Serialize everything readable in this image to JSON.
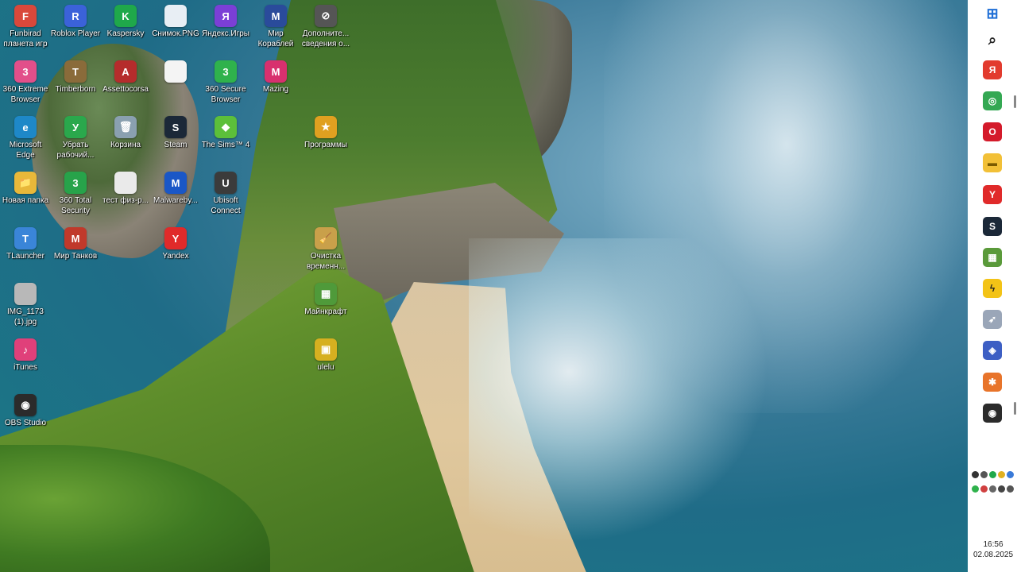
{
  "desktop_icons": [
    {
      "label": "Funbirad\nпланета игр",
      "glyph": "F",
      "color": "#d9483b",
      "col": 0,
      "row": 0
    },
    {
      "label": "Roblox Player",
      "glyph": "R",
      "color": "#3b62d9",
      "col": 1,
      "row": 0
    },
    {
      "label": "Kaspersky",
      "glyph": "K",
      "color": "#1fa84a",
      "col": 2,
      "row": 0
    },
    {
      "label": "Снимок.PNG",
      "glyph": "",
      "color": "#e8eef4",
      "col": 3,
      "row": 0
    },
    {
      "label": "Яндекс.Игры",
      "glyph": "Я",
      "color": "#7b3fd6",
      "col": 4,
      "row": 0
    },
    {
      "label": "Мир\nКораблей",
      "glyph": "M",
      "color": "#2a4b9b",
      "col": 5,
      "row": 0
    },
    {
      "label": "Дополните...\nсведения о...",
      "glyph": "⊘",
      "color": "#555555",
      "col": 6,
      "row": 0
    },
    {
      "label": "360 Extreme\nBrowser",
      "glyph": "3",
      "color": "#e24f8a",
      "col": 0,
      "row": 1
    },
    {
      "label": "Timberborn",
      "glyph": "T",
      "color": "#8a6b3a",
      "col": 1,
      "row": 1
    },
    {
      "label": "Assettocorsa",
      "glyph": "A",
      "color": "#b52c2c",
      "col": 2,
      "row": 1
    },
    {
      "label": "",
      "glyph": "",
      "color": "#f4f4f4",
      "col": 3,
      "row": 1
    },
    {
      "label": "360 Secure\nBrowser",
      "glyph": "3",
      "color": "#2fb24c",
      "col": 4,
      "row": 1
    },
    {
      "label": "Mazing",
      "glyph": "M",
      "color": "#d8306e",
      "col": 5,
      "row": 1
    },
    {
      "label": "Microsoft\nEdge",
      "glyph": "e",
      "color": "#1e88c8",
      "col": 0,
      "row": 2
    },
    {
      "label": "Убрать\nрабочий...",
      "glyph": "У",
      "color": "#2aa84c",
      "col": 1,
      "row": 2
    },
    {
      "label": "Корзина",
      "glyph": "🗑",
      "color": "#8aa0b0",
      "col": 2,
      "row": 2
    },
    {
      "label": "Steam",
      "glyph": "S",
      "color": "#1b2838",
      "col": 3,
      "row": 2
    },
    {
      "label": "The Sims™ 4",
      "glyph": "◆",
      "color": "#5cbf3a",
      "col": 4,
      "row": 2
    },
    {
      "label": "Программы",
      "glyph": "★",
      "color": "#e0a020",
      "col": 6,
      "row": 2
    },
    {
      "label": "Новая папка",
      "glyph": "📁",
      "color": "#e8b83a",
      "col": 0,
      "row": 3
    },
    {
      "label": "360 Total\nSecurity",
      "glyph": "3",
      "color": "#27a34a",
      "col": 1,
      "row": 3
    },
    {
      "label": "тест физ-р...",
      "glyph": "",
      "color": "#eaeaea",
      "col": 2,
      "row": 3
    },
    {
      "label": "Malwareby...",
      "glyph": "M",
      "color": "#1a57c7",
      "col": 3,
      "row": 3
    },
    {
      "label": "Ubisoft\nConnect",
      "glyph": "U",
      "color": "#3b3b3b",
      "col": 4,
      "row": 3
    },
    {
      "label": "TLauncher",
      "glyph": "T",
      "color": "#3a85d8",
      "col": 0,
      "row": 4
    },
    {
      "label": "Мир Танков",
      "glyph": "M",
      "color": "#c0392b",
      "col": 1,
      "row": 4
    },
    {
      "label": "Yandex",
      "glyph": "Y",
      "color": "#e02a2a",
      "col": 3,
      "row": 4
    },
    {
      "label": "Очистка\nвременн...",
      "glyph": "🧹",
      "color": "#c9a04a",
      "col": 6,
      "row": 4
    },
    {
      "label": "Майнкрафт",
      "glyph": "▦",
      "color": "#4f9a3a",
      "col": 6,
      "row": 5
    },
    {
      "label": "IMG_1173\n(1).jpg",
      "glyph": "",
      "color": "#b8b8b8",
      "col": 0,
      "row": 5
    },
    {
      "label": "iTunes",
      "glyph": "♪",
      "color": "#e0407a",
      "col": 0,
      "row": 6
    },
    {
      "label": "ulelu",
      "glyph": "▣",
      "color": "#d6b020",
      "col": 6,
      "row": 6
    },
    {
      "label": "OBS Studio",
      "glyph": "◉",
      "color": "#2b2b2b",
      "col": 0,
      "row": 7
    }
  ],
  "taskbar": {
    "buttons": [
      {
        "name": "start-button",
        "icon": "windows-icon",
        "glyph": "⊞",
        "color": "#1f6fd6",
        "text_color": "#1f6fd6"
      },
      {
        "name": "search-button",
        "icon": "search-icon",
        "glyph": "⌕",
        "color": "#222222",
        "text_color": "#222222"
      },
      {
        "name": "taskbar-yandex",
        "icon": "yandex-icon",
        "glyph": "Я",
        "color": "#e23b2e",
        "text_color": "#ffffff"
      },
      {
        "name": "taskbar-chrome",
        "icon": "chrome-icon",
        "glyph": "◎",
        "color": "#34a853",
        "text_color": "#ffffff"
      },
      {
        "name": "taskbar-opera",
        "icon": "opera-icon",
        "glyph": "O",
        "color": "#d41a2a",
        "text_color": "#ffffff"
      },
      {
        "name": "taskbar-explorer",
        "icon": "folder-icon",
        "glyph": "▬",
        "color": "#f2c037",
        "text_color": "#7a5a00"
      },
      {
        "name": "taskbar-yandex-browser",
        "icon": "yandex-browser-icon",
        "glyph": "Y",
        "color": "#e02a2a",
        "text_color": "#ffffff"
      },
      {
        "name": "taskbar-steam",
        "icon": "steam-icon",
        "glyph": "S",
        "color": "#1b2838",
        "text_color": "#ffffff"
      },
      {
        "name": "taskbar-minecraft",
        "icon": "minecraft-icon",
        "glyph": "▦",
        "color": "#5a9a3a",
        "text_color": "#ffffff"
      },
      {
        "name": "taskbar-app-yellow",
        "icon": "lightning-icon",
        "glyph": "ϟ",
        "color": "#f3c316",
        "text_color": "#222222"
      },
      {
        "name": "taskbar-app-rocket",
        "icon": "rocket-icon",
        "glyph": "➶",
        "color": "#9aa6b8",
        "text_color": "#ffffff"
      },
      {
        "name": "taskbar-app-shield",
        "icon": "shield-icon",
        "glyph": "◈",
        "color": "#3d5fc4",
        "text_color": "#ffffff"
      },
      {
        "name": "taskbar-app-orange",
        "icon": "star-badge-icon",
        "glyph": "✱",
        "color": "#e8742a",
        "text_color": "#ffffff"
      },
      {
        "name": "taskbar-obs",
        "icon": "obs-icon",
        "glyph": "◉",
        "color": "#2b2b2b",
        "text_color": "#ffffff"
      }
    ]
  },
  "tray": {
    "icons": [
      {
        "name": "tray-obs-icon",
        "color": "#333333"
      },
      {
        "name": "tray-obs2-icon",
        "color": "#555555"
      },
      {
        "name": "tray-kaspersky-icon",
        "color": "#1fa84a"
      },
      {
        "name": "tray-folder-icon",
        "color": "#e0b020"
      },
      {
        "name": "tray-app-icon",
        "color": "#3a7ad8"
      },
      {
        "name": "tray-green-icon",
        "color": "#2fb24c"
      },
      {
        "name": "tray-red-icon",
        "color": "#d04040"
      },
      {
        "name": "tray-usb-icon",
        "color": "#666666"
      },
      {
        "name": "tray-volume-icon",
        "color": "#444444"
      },
      {
        "name": "tray-battery-icon",
        "color": "#555555"
      }
    ],
    "time": "16:56",
    "date": "02.08.2025"
  }
}
